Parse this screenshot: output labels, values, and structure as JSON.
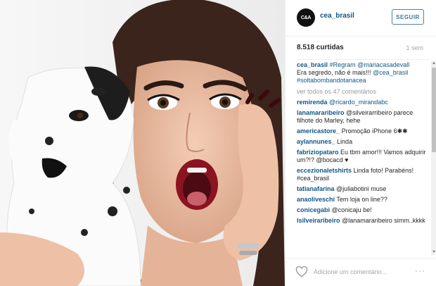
{
  "post": {
    "username": "cea_brasil",
    "avatar_text": "C&A",
    "follow_label": "SEGUIR",
    "likes": "8.518 curtidas",
    "time": "1 sem"
  },
  "caption": {
    "user": "cea_brasil",
    "line1_tags": "#Regram @mariacasadevall",
    "line2": "Era segredo, não é mais!!!",
    "line2_tag": "@cea_brasil",
    "line3_tag": "#soltabombandotanacea"
  },
  "view_all": "ver todos os 47 comentários",
  "comments": [
    {
      "user": "remirenda",
      "text": "@ricardo_mirandabc"
    },
    {
      "user": "lanamararibeiro",
      "text": "@silveirarribeiro parece filhote do Marley, hehe"
    },
    {
      "user": "americastore_",
      "text": "Promoção iPhone 6✱✱"
    },
    {
      "user": "aylannunes_",
      "text": "Linda"
    },
    {
      "user": "fabriziopataro",
      "text": "Eu tbm amor!!! Vamos adquirir um?!? @bocacd ♥"
    },
    {
      "user": "eccezionaletshirts",
      "text": "Linda foto! Parabéns! #cea_brasil"
    },
    {
      "user": "tatianafarina",
      "text": "@juliabotini muse"
    },
    {
      "user": "anaoliveschi",
      "text": "Tem loja on line??"
    },
    {
      "user": "conicegabi",
      "text": "@conicaju be!"
    },
    {
      "user": "lsilveiraribeiro",
      "text": "@lanamararibeiro simm..kkkk"
    }
  ],
  "footer": {
    "add_comment_placeholder": "Adicione um comentário...",
    "more_label": "···"
  },
  "colors": {
    "link": "#125688",
    "follow": "#3f729b",
    "muted": "#a5a7aa"
  },
  "icons": [
    "heart-icon",
    "more-icon",
    "scroll-up-icon",
    "scroll-down-icon"
  ]
}
